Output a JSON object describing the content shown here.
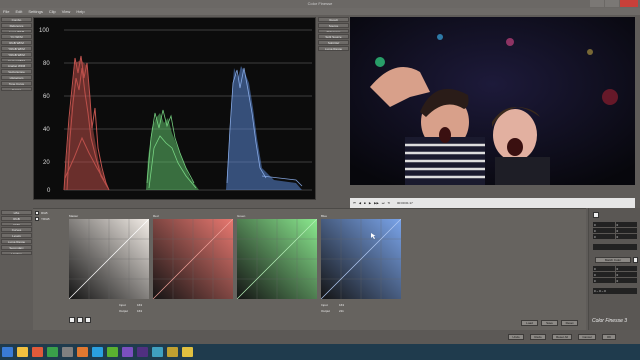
{
  "app": {
    "title": "Color Finesse"
  },
  "menu": [
    "File",
    "Edit",
    "Settings",
    "Clip",
    "View",
    "Help"
  ],
  "left_scope_buttons": [
    "Combo",
    "Reference",
    "Luma WFM",
    "YC WFM",
    "RGB WFM",
    "YRGB WFM",
    "YRGB WFM",
    "Vector WFM",
    "Analog WFM",
    "Vectorscope",
    "Histogram",
    "Tone Curve",
    "Gamut"
  ],
  "view_buttons": [
    "Result",
    "Source",
    "Reference",
    "Split Source",
    "Split Ref",
    "Luma Range"
  ],
  "scope": {
    "ticks": [
      "100",
      "80",
      "60",
      "40",
      "20",
      "0"
    ]
  },
  "transport": {
    "timecode": "00:00:01:17"
  },
  "left_params": [
    "HSL",
    "RGB",
    "CMY",
    "Curves",
    "Levels",
    "Luma Range",
    "Secondary",
    "Limiting"
  ],
  "tone_tabs": [
    "RGB",
    "YRGB"
  ],
  "curves": [
    {
      "label": "Master",
      "input_label": "Input",
      "output_label": "Output",
      "input": "163",
      "output": "163"
    },
    {
      "label": "Red",
      "input_label": "",
      "output_label": "",
      "input": "",
      "output": ""
    },
    {
      "label": "Green",
      "input_label": "",
      "output_label": "",
      "input": "",
      "output": ""
    },
    {
      "label": "Blue",
      "input_label": "Input",
      "output_label": "Output",
      "input": "163",
      "output": "211"
    }
  ],
  "curve_actions": [
    "Load",
    "Save",
    "Reset"
  ],
  "right_panel": {
    "readouts": [
      "0",
      "0",
      "0",
      "0",
      "0",
      "0"
    ],
    "match_label": "Match Color",
    "readouts2": [
      "0",
      "0",
      "0",
      "0",
      "0",
      "0"
    ],
    "footer": "0 ~ 0 ~ 0"
  },
  "bottom_buttons": [
    "Undo",
    "Redo",
    "Reset All",
    "Cancel",
    "OK"
  ],
  "brand": "Color Finesse 3",
  "colors": {
    "red": "#e0605a",
    "green": "#6fd07a",
    "blue": "#6f9be6",
    "panel": "#66635f",
    "taskbar": "#1f3b4d"
  }
}
